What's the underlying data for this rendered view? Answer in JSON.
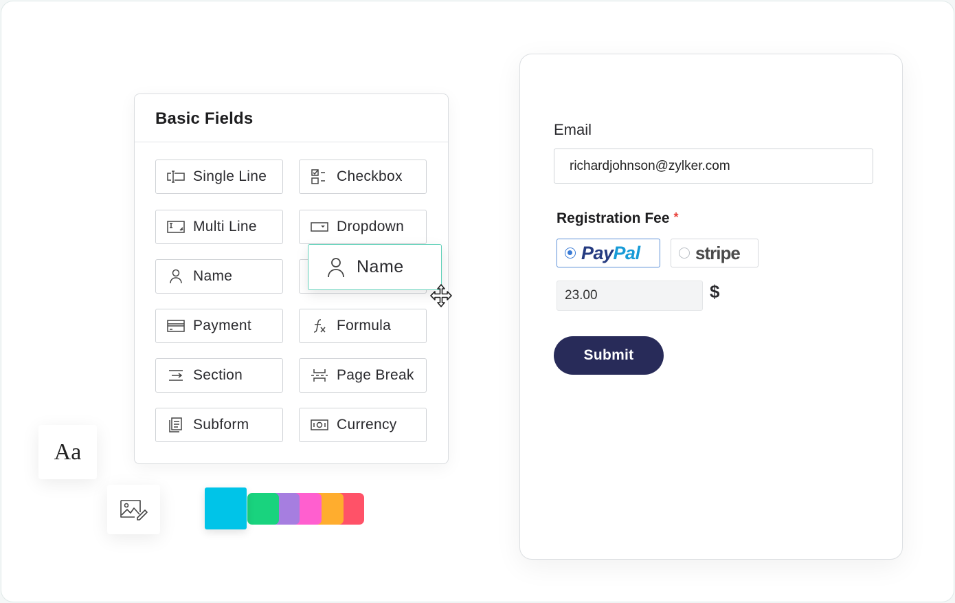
{
  "panel": {
    "title": "Basic Fields",
    "fields": [
      {
        "label": "Single Line",
        "icon": "single-line-icon"
      },
      {
        "label": "Checkbox",
        "icon": "checkbox-icon"
      },
      {
        "label": "Multi Line",
        "icon": "multi-line-icon"
      },
      {
        "label": "Dropdown",
        "icon": "dropdown-icon"
      },
      {
        "label": "Name",
        "icon": "person-icon"
      },
      {
        "label": "Payment",
        "icon": "card-icon"
      },
      {
        "label": "Formula",
        "icon": "formula-icon"
      },
      {
        "label": "Section",
        "icon": "section-icon"
      },
      {
        "label": "Page Break",
        "icon": "page-break-icon"
      },
      {
        "label": "Subform",
        "icon": "subform-icon"
      },
      {
        "label": "Currency",
        "icon": "currency-icon"
      }
    ],
    "dragging": {
      "label": "Name",
      "icon": "person-icon"
    }
  },
  "tools": {
    "typography_label": "Aa",
    "image_icon": "image-edit-icon",
    "palette": [
      "#00c4e8",
      "#19d37e",
      "#a67ee0",
      "#ff5fcf",
      "#ffad2e",
      "#ff5268"
    ]
  },
  "form": {
    "email_label": "Email",
    "email_value": "richardjohnson@zylker.com",
    "fee_label": "Registration Fee",
    "required_mark": "*",
    "payment_options": {
      "paypal_part1": "Pay",
      "paypal_part2": "Pal",
      "stripe": "stripe"
    },
    "amount_value": "23.00",
    "currency_symbol": "$",
    "submit_label": "Submit"
  }
}
